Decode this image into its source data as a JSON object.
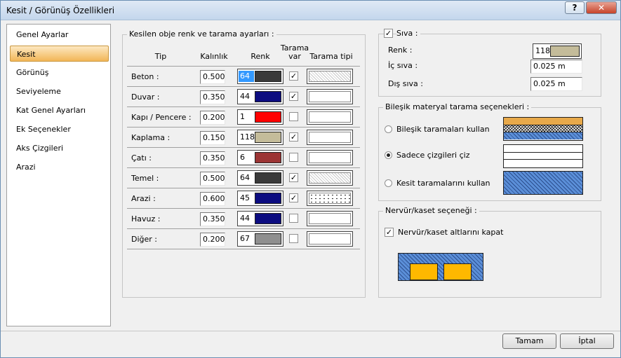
{
  "window": {
    "title": "Kesit / Görünüş Özellikleri",
    "help_label": "?",
    "close_label": "✕"
  },
  "sidebar": {
    "items": [
      {
        "label": "Genel Ayarlar",
        "active": false
      },
      {
        "label": "Kesit",
        "active": true
      },
      {
        "label": "Görünüş",
        "active": false
      },
      {
        "label": "Seviyeleme",
        "active": false
      },
      {
        "label": "Kat Genel Ayarları",
        "active": false
      },
      {
        "label": "Ek Seçenekler",
        "active": false
      },
      {
        "label": "Aks Çizgileri",
        "active": false
      },
      {
        "label": "Arazi",
        "active": false
      }
    ]
  },
  "table": {
    "group_label": "Kesilen obje renk ve tarama ayarları :",
    "headers": {
      "tip": "Tip",
      "kalinlik": "Kalınlık",
      "renk": "Renk",
      "tarama_var_1": "Tarama",
      "tarama_var_2": "var",
      "tarama_tipi": "Tarama tipi"
    },
    "rows": [
      {
        "label": "Beton :",
        "thickness": "0.500",
        "color_num": "64",
        "color": "#3a3a3a",
        "selected": true,
        "tarama": true,
        "pattern": "hatch"
      },
      {
        "label": "Duvar :",
        "thickness": "0.350",
        "color_num": "44",
        "color": "#0c0c80",
        "selected": false,
        "tarama": true,
        "pattern": "none"
      },
      {
        "label": "Kapı / Pencere :",
        "thickness": "0.200",
        "color_num": "1",
        "color": "#ff0000",
        "selected": false,
        "tarama": false,
        "pattern": "none"
      },
      {
        "label": "Kaplama :",
        "thickness": "0.150",
        "color_num": "118",
        "color": "#c4bc9a",
        "selected": false,
        "tarama": true,
        "pattern": "none"
      },
      {
        "label": "Çatı :",
        "thickness": "0.350",
        "color_num": "6",
        "color": "#9c3434",
        "selected": false,
        "tarama": false,
        "pattern": "none"
      },
      {
        "label": "Temel :",
        "thickness": "0.500",
        "color_num": "64",
        "color": "#3a3a3a",
        "selected": false,
        "tarama": true,
        "pattern": "hatch"
      },
      {
        "label": "Arazi :",
        "thickness": "0.600",
        "color_num": "45",
        "color": "#0c0c80",
        "selected": false,
        "tarama": true,
        "pattern": "dots"
      },
      {
        "label": "Havuz :",
        "thickness": "0.350",
        "color_num": "44",
        "color": "#0c0c80",
        "selected": false,
        "tarama": false,
        "pattern": "none"
      },
      {
        "label": "Diğer :",
        "thickness": "0.200",
        "color_num": "67",
        "color": "#8f8f8f",
        "selected": false,
        "tarama": false,
        "pattern": "none"
      }
    ]
  },
  "siva": {
    "label": "Sıva :",
    "checked": true,
    "renk_label": "Renk :",
    "renk_num": "118",
    "renk_color": "#c4bc9a",
    "ic_label": "İç sıva :",
    "ic_value": "0.025 m",
    "dis_label": "Dış sıva :",
    "dis_value": "0.025 m"
  },
  "bilesik": {
    "label": "Bileşik materyal tarama seçenekleri :",
    "options": [
      {
        "label": "Bileşik taramaları kullan",
        "selected": false
      },
      {
        "label": "Sadece çizgileri çiz",
        "selected": true
      },
      {
        "label": "Kesit taramalarını kullan",
        "selected": false
      }
    ]
  },
  "nervur": {
    "label": "Nervür/kaset seçeneği :",
    "check_label": "Nervür/kaset altlarını kapat",
    "checked": true
  },
  "buttons": {
    "ok": "Tamam",
    "cancel": "İptal"
  }
}
